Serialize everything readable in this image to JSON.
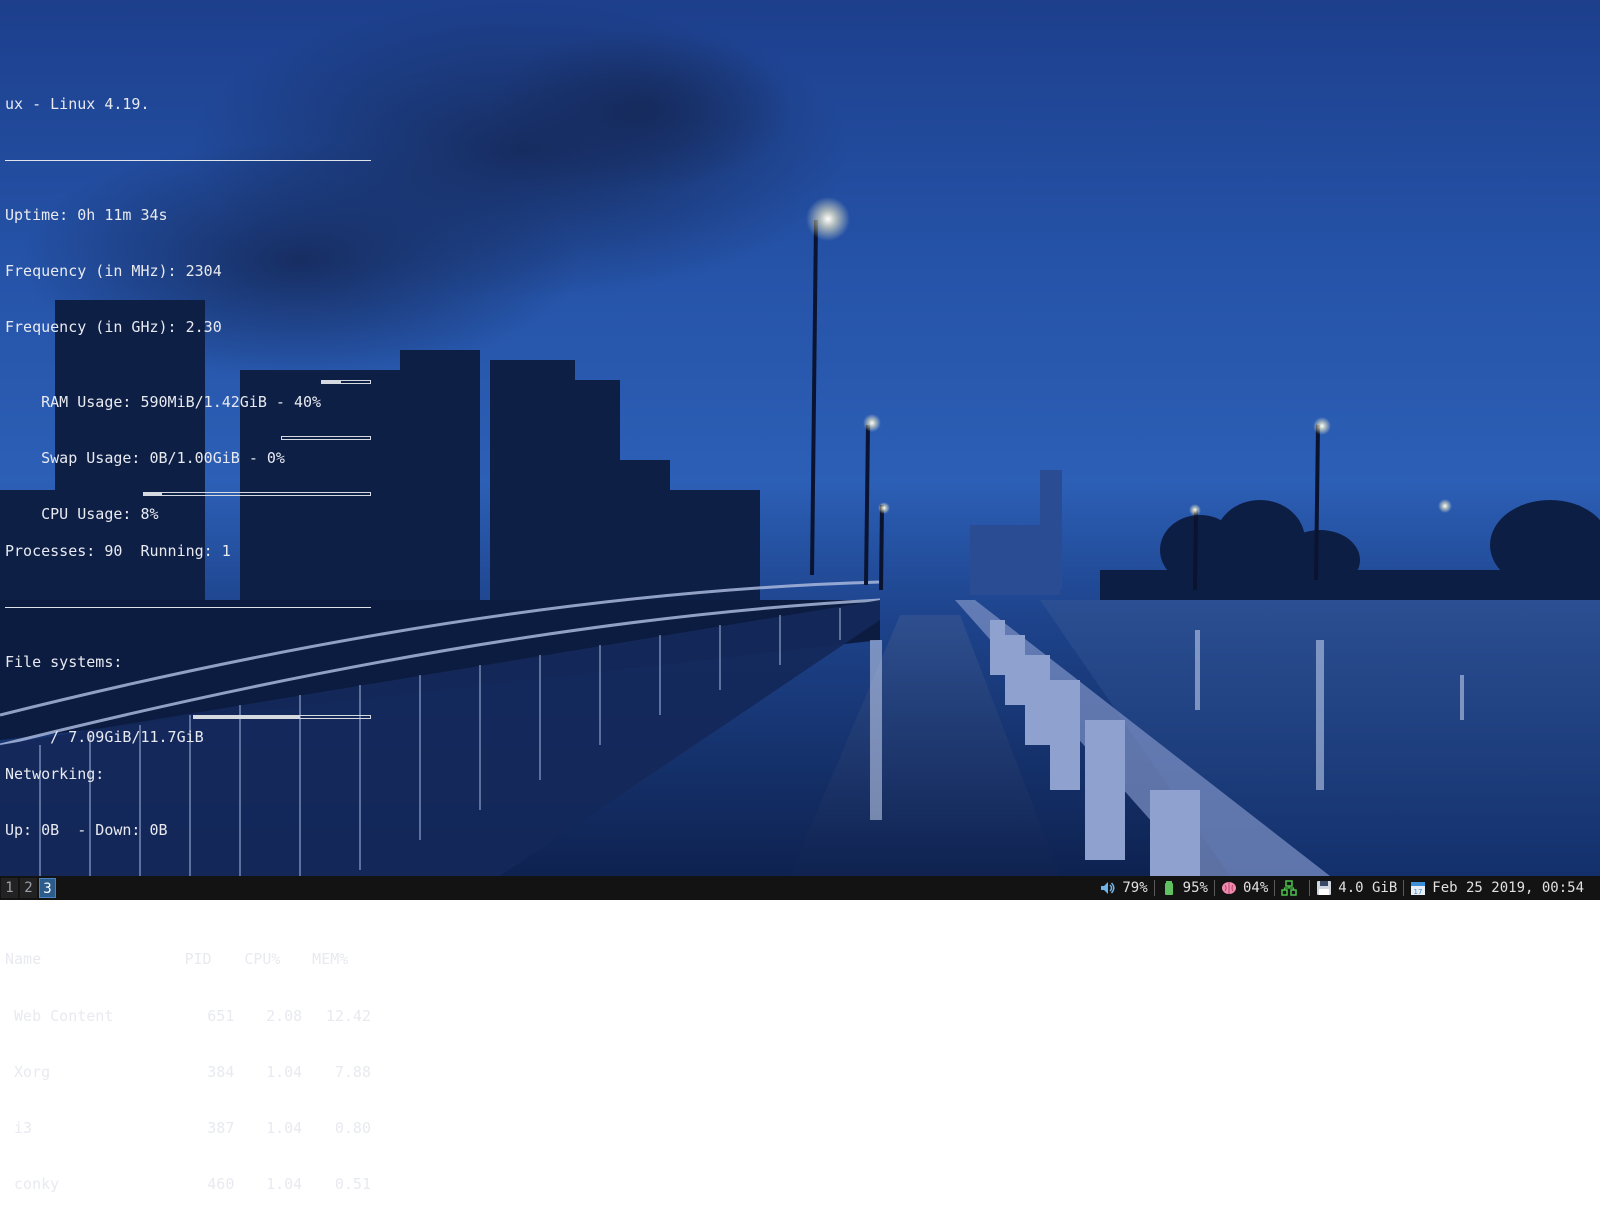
{
  "conky": {
    "title": "ux - Linux 4.19.",
    "uptime": "Uptime: 0h 11m 34s",
    "freq_mhz": "Frequency (in MHz): 2304",
    "freq_ghz": "Frequency (in GHz): 2.30",
    "ram_usage": "RAM Usage: 590MiB/1.42GiB - 40%",
    "ram_percent": 40,
    "swap_usage": "Swap Usage: 0B/1.00GiB - 0%",
    "swap_percent": 0,
    "cpu_usage": "CPU Usage: 8%",
    "cpu_percent": 8,
    "processes": "Processes: 90  Running: 1",
    "fs_heading": "File systems:",
    "fs_root": " / 7.09GiB/11.7GiB",
    "fs_percent": 60,
    "net_heading": "Networking:",
    "net_updown": "Up: 0B  - Down: 0B",
    "proc_headers": {
      "name": "Name",
      "pid": "PID",
      "cpu": "CPU%",
      "mem": "MEM%"
    },
    "procs": [
      {
        "name": " Web Content",
        "pid": "651",
        "cpu": "2.08",
        "mem": "12.42"
      },
      {
        "name": " Xorg",
        "pid": "384",
        "cpu": "1.04",
        "mem": "7.88"
      },
      {
        "name": " i3",
        "pid": "387",
        "cpu": "1.04",
        "mem": "0.80"
      },
      {
        "name": " conky",
        "pid": "460",
        "cpu": "1.04",
        "mem": "0.51"
      }
    ]
  },
  "i3bar": {
    "workspaces": [
      {
        "label": "1",
        "active": false
      },
      {
        "label": "2",
        "active": false
      },
      {
        "label": "3",
        "active": true
      }
    ],
    "volume": {
      "icon": "speaker-icon",
      "text": "79%"
    },
    "battery": {
      "icon": "battery-icon",
      "text": "95%"
    },
    "cpu": {
      "icon": "brain-icon",
      "text": "04%"
    },
    "network": {
      "icon": "network-icon"
    },
    "disk": {
      "icon": "floppy-disk-icon",
      "text": "4.0 GiB"
    },
    "datetime": {
      "icon": "calendar-icon",
      "text": "Feb 25 2019, 00:54"
    }
  },
  "colors": {
    "bar_bg": "#131313",
    "active_workspace": "#2b5c8c",
    "conky_text": "#e8eaf0"
  }
}
